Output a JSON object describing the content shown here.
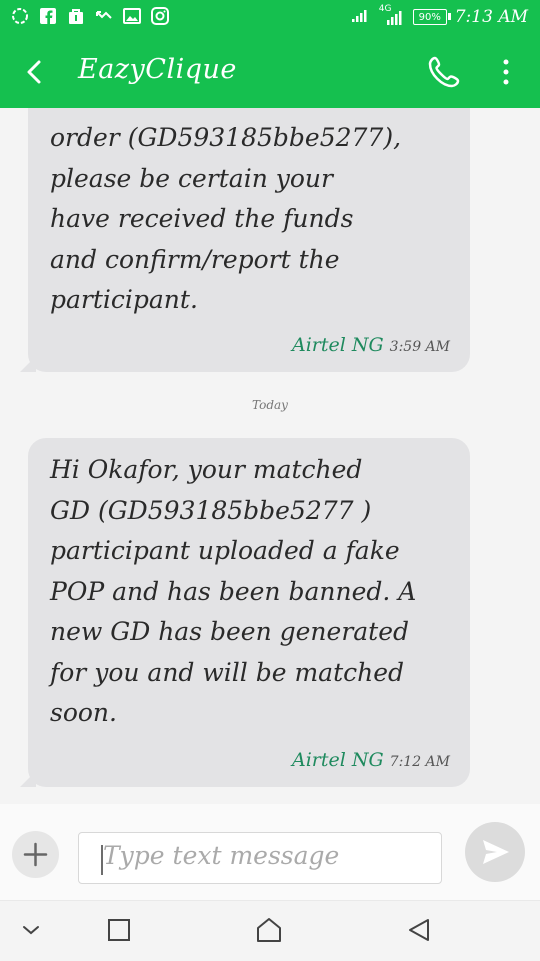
{
  "status_bar": {
    "battery": "90%",
    "time": "7:13 AM",
    "signal_label": "4G"
  },
  "app_bar": {
    "title": "EazyClique"
  },
  "thread": {
    "messages": [
      {
        "text": "order (GD593185bbe5277),\nplease be certain your\nhave received the funds\nand confirm/report the\nparticipant.",
        "sender": "Airtel NG",
        "time": "3:59 AM"
      },
      {
        "text": "Hi Okafor, your matched\nGD (GD593185bbe5277 )\nparticipant uploaded a fake\nPOP and has been banned. A\nnew GD has been generated\nfor you and will be matched\nsoon.",
        "sender": "Airtel NG",
        "time": "7:12 AM"
      }
    ],
    "date_separator": "Today"
  },
  "composer": {
    "placeholder": "Type text message"
  },
  "colors": {
    "accent": "#15c04f",
    "bubble": "#e3e3e5",
    "sender": "#1f8a5e"
  },
  "icons": {
    "back": "chevron-left-icon",
    "call": "phone-icon",
    "more": "more-vertical-icon",
    "add": "plus-icon",
    "send": "send-icon"
  }
}
